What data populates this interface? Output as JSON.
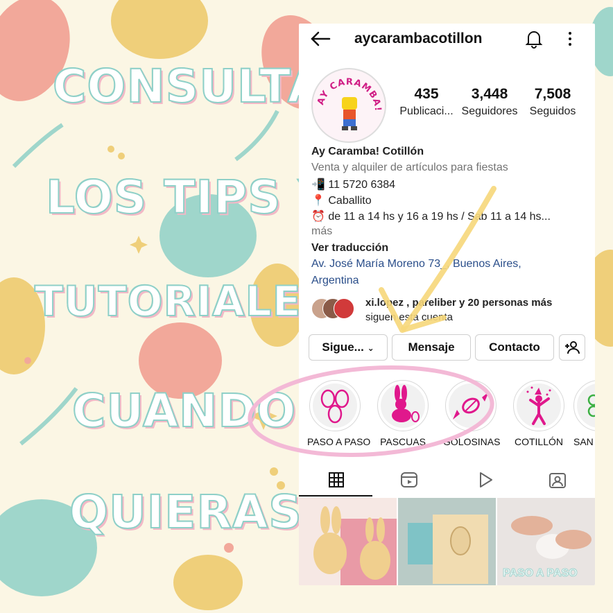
{
  "headline": [
    "CONSULTÁ",
    "LOS TIPS Y",
    "TUTORIALES",
    "CUANDO",
    "QUIERAS"
  ],
  "profile": {
    "username": "aycarambacotillon",
    "avatar_text": "AY CARAMBA!",
    "stats": [
      {
        "num": "435",
        "label": "Publicaci..."
      },
      {
        "num": "3,448",
        "label": "Seguidores"
      },
      {
        "num": "7,508",
        "label": "Seguidos"
      }
    ],
    "name": "Ay Caramba! Cotillón",
    "category": "Venta y alquiler de artículos para fiestas",
    "phone": "📲 11 5720 6384",
    "location": "📍 Caballito",
    "hours": "⏰ de 11 a 14 hs y 16 a 19 hs / Sab 11 a 14 hs...",
    "more": "más",
    "translate": "Ver traducción",
    "address_line1": "Av. José María Moreno 73_, Buenos Aires,",
    "address_line2": "Argentina",
    "followed_by_line1": "xi.lopez , pareliber y 20 personas más",
    "followed_by_line2": "siguen esta cuenta"
  },
  "buttons": {
    "following": "Sigue...",
    "message": "Mensaje",
    "contact": "Contacto"
  },
  "highlights": [
    {
      "label": "PASO A PASO"
    },
    {
      "label": "PASCUAS"
    },
    {
      "label": "GOLOSINAS"
    },
    {
      "label": "COTILLÓN"
    },
    {
      "label": "SAN"
    }
  ],
  "thumb_caption": "PASO A PASO",
  "colors": {
    "accent_pink": "#e0188c",
    "annotation_pink": "#f3b9d6",
    "annotation_yellow": "#f6d77a",
    "headline_stroke": "#8fd0c8"
  }
}
